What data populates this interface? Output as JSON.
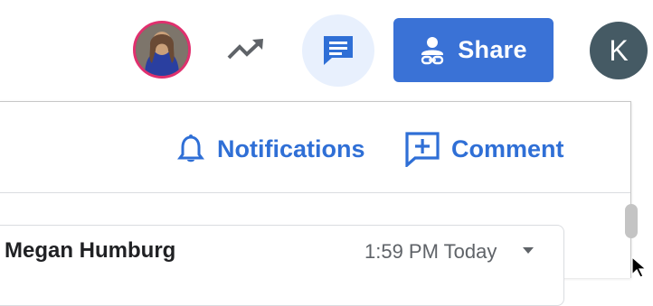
{
  "toolbar": {
    "share_label": "Share",
    "account_initial": "K"
  },
  "panel": {
    "notifications_label": "Notifications",
    "comment_label": "Comment"
  },
  "comment": {
    "author": "Megan Humburg",
    "time": "1:59 PM Today"
  },
  "icons": {
    "trend": "trending-up-icon",
    "comments": "comments-icon",
    "share": "share-person-link-icon",
    "notifications": "bell-icon",
    "comment": "add-comment-icon",
    "caret": "caret-down-icon"
  },
  "colors": {
    "accent_blue": "#3a72d6",
    "link_blue": "#2f6fd6",
    "comments_bg": "#e8f0fd",
    "avatar_ring": "#e0306e",
    "account_bg": "#455a64"
  }
}
